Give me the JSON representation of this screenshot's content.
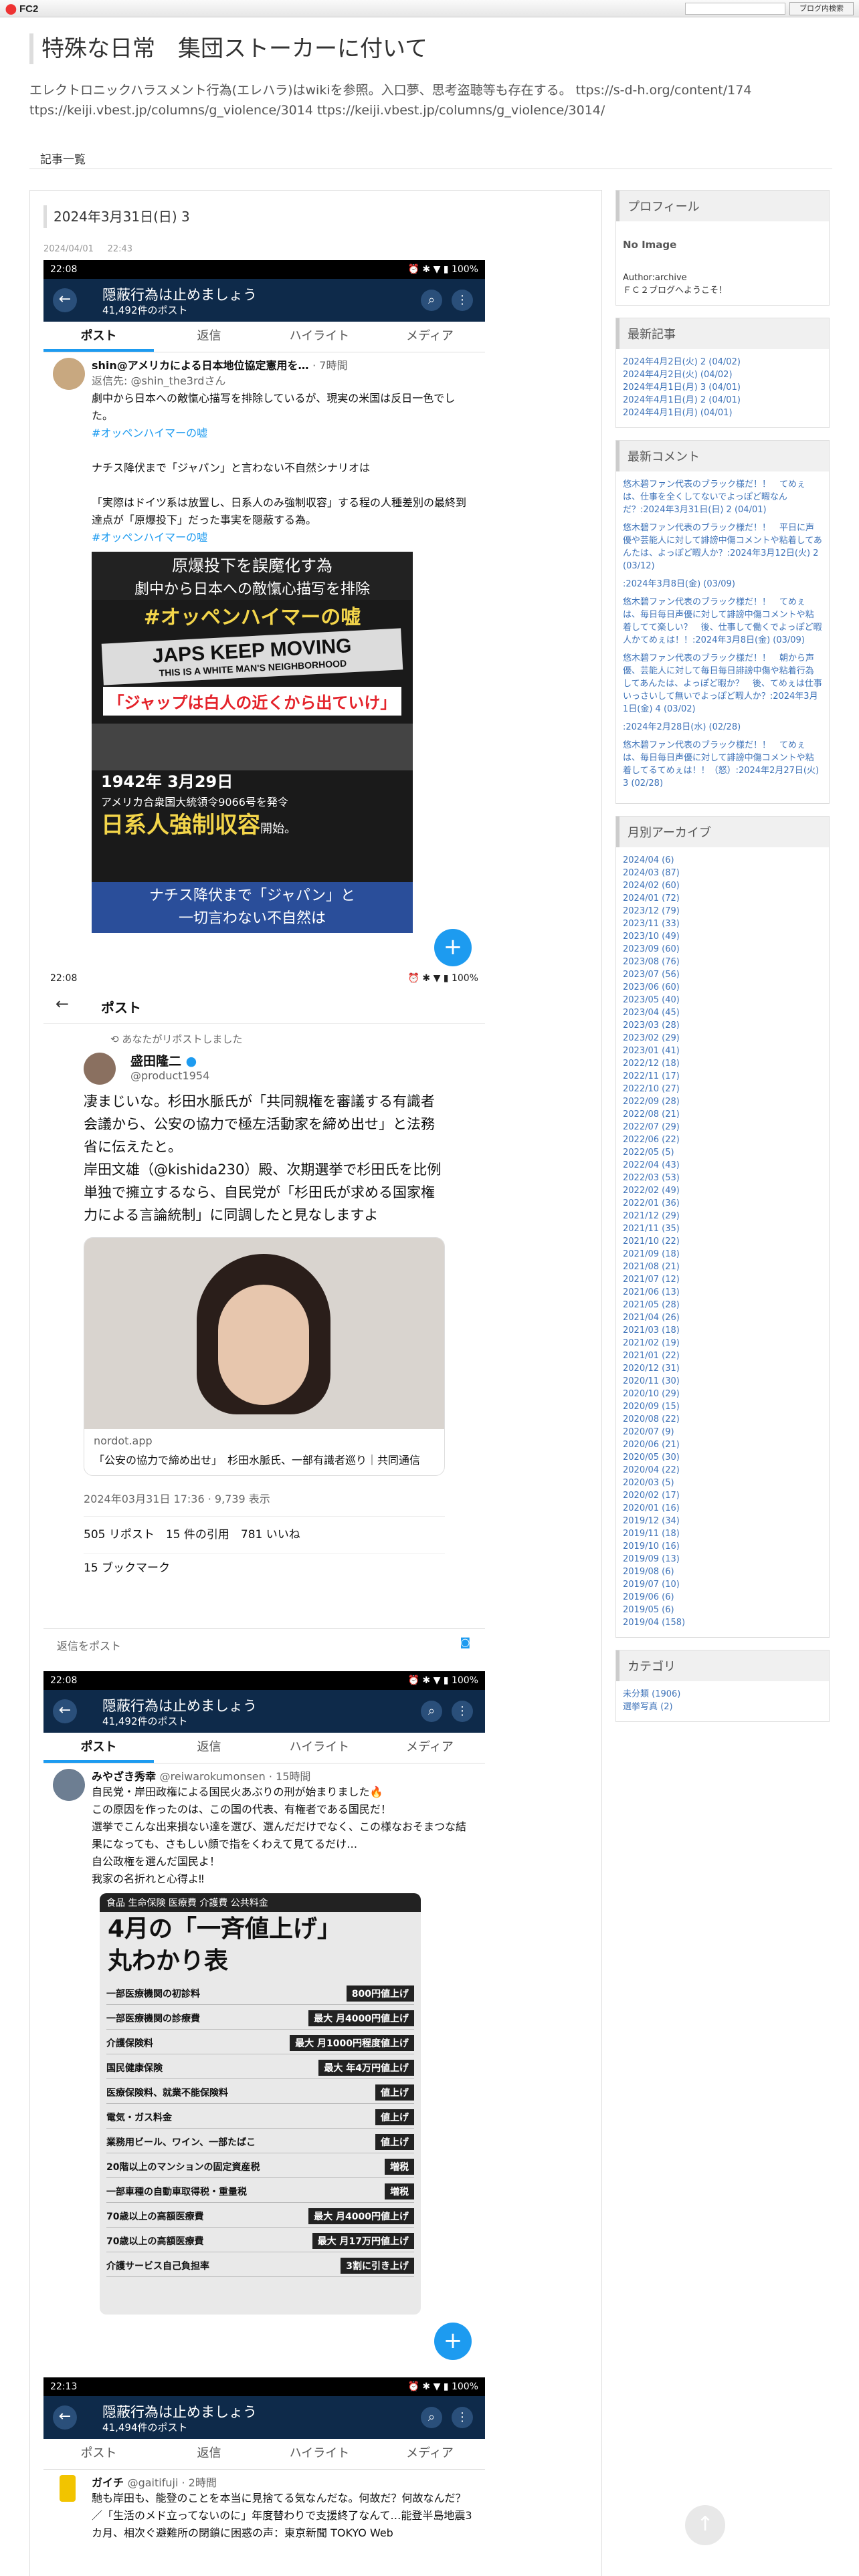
{
  "topbar": {
    "logo": "FC2",
    "search_button": "ブログ内検索"
  },
  "blog": {
    "title": "特殊な日常　集団ストーカーに付いて",
    "description": "エレクトロニックハラスメント行為(エレハラ)はwikiを参照。入口夢、思考盗聴等も存在する。 ttps://s-d-h.org/content/174 ttps://keiji.vbest.jp/columns/g_violence/3014 ttps://keiji.vbest.jp/columns/g_violence/3014/"
  },
  "nav": {
    "list_link": "記事一覧"
  },
  "entry": {
    "heading": "2024年3月31日(日) 3",
    "date": "2024/04/01",
    "time": "22:43"
  },
  "shot1": {
    "time": "22:08",
    "status": "⏰ ✱ ▼ ▮ 100%",
    "header_title": "隠蔽行為は止めましょう",
    "header_sub": "41,492件のポスト",
    "tabs": [
      "ポスト",
      "返信",
      "ハイライト",
      "メディア"
    ],
    "author": "shin@アメリカによる日本地位協定憲用を…",
    "author_time": "· 7時間",
    "reply_to": "返信先: @shin_the3rdさん",
    "lines": [
      "劇中から日本への敵愾心描写を排除しているが、現実の米国は反日一色でした。",
      "#オッペンハイマーの嘘",
      "",
      "ナチス降伏まで「ジャパン」と言わない不自然シナリオは",
      "",
      "「実際はドイツ系は放置し、日系人のみ強制収容」する程の人種差別の最終到達点が「原爆投下」だった事実を隠蔽する為。",
      "#オッペンハイマーの嘘"
    ],
    "poster": {
      "line1": "原爆投下を誤魔化す為",
      "line2": "劇中から日本への敵愾心描写を排除",
      "hashtag": "#オッペンハイマーの嘘",
      "sign1": "JAPS KEEP MOVING",
      "sign2": "THIS IS A WHITE MAN'S NEIGHBORHOOD",
      "red_caption": "「ジャップは白人の近くから出ていけ」",
      "date_line": "1942年 3月29日",
      "order_line": "アメリカ合衆国大統領令9066号を発令",
      "yellow_big": "日系人強制収容",
      "yellow_tail": "開始。",
      "bottom1": "ナチス降伏まで「ジャパン」と",
      "bottom2": "一切言わない不自然は"
    },
    "fab": "+"
  },
  "shot2": {
    "time": "22:08",
    "status": "⏰ ✱ ▼ ▮ 100%",
    "header": "ポスト",
    "repost_note": "あなたがリポストしました",
    "author": "盛田隆二",
    "handle": "@product1954",
    "lines": [
      "凄まじいな。杉田水脈氏が「共同親権を審議する有識者会議から、公安の協力で極左活動家を締め出せ」と法務省に伝えたと。",
      "岸田文雄（@kishida230）殿、次期選挙で杉田氏を比例単独で擁立するなら、自民党が「杉田氏が求める国家権力による言論統制」に同調したと見なしますよ"
    ],
    "card_domain": "nordot.app",
    "card_title": "「公安の協力で締め出せ」　杉田水脈氏、一部有識者巡り｜共同通信",
    "meta": "2024年03月31日 17:36 · 9,739 表示",
    "stats": "505 リポスト　15 件の引用　781 いいね",
    "bookmarks": "15 ブックマーク",
    "reply_placeholder": "返信をポスト"
  },
  "shot3": {
    "time": "22:08",
    "status": "⏰ ✱ ▼ ▮ 100%",
    "header_title": "隠蔽行為は止めましょう",
    "header_sub": "41,492件のポスト",
    "tabs": [
      "ポスト",
      "返信",
      "ハイライト",
      "メディア"
    ],
    "author": "みやざき秀幸",
    "handle": "@reiwarokumonsen · 15時間",
    "lines": [
      "自民党・岸田政権による国民火あぶりの刑が始まりました🔥",
      "この原因を作ったのは、この国の代表、有権者である国民だ！",
      "選挙でこんな出来損ない達を選び、選んだだけでなく、この様なおそまつな結果になっても、さもしい顔で指をくわえて見てるだけ…",
      "自公政権を選んだ国民よ！",
      "我家の名折れと心得よ‼"
    ],
    "poster_top": "食品 生命保険 医療費 介護費 公共料金",
    "poster_title1": "4月の「一斉値上げ」",
    "poster_title2": "丸わかり表",
    "rows": [
      {
        "label": "一部医療機関の初診料",
        "tag": "800円値上げ"
      },
      {
        "label": "一部医療機関の診療費",
        "tag": "最大 月4000円値上げ"
      },
      {
        "label": "介護保険料",
        "tag": "最大 月1000円程度値上げ"
      },
      {
        "label": "国民健康保険",
        "tag": "最大 年4万円値上げ"
      },
      {
        "label": "医療保険料、就業不能保険料",
        "tag": "値上げ"
      },
      {
        "label": "電気・ガス料金",
        "tag": "値上げ"
      },
      {
        "label": "業務用ビール、ワイン、一部たばこ",
        "tag": "値上げ"
      },
      {
        "label": "20階以上のマンションの固定資産税",
        "tag": "増税"
      },
      {
        "label": "一部車種の自動車取得税・重量税",
        "tag": "増税"
      },
      {
        "label": "70歳以上の高額医療費",
        "tag": "最大 月4000円値上げ"
      },
      {
        "label": "70歳以上の高額医療費",
        "tag": "最大 月17万円値上げ"
      },
      {
        "label": "介護サービス自己負担率",
        "tag": "3割に引き上げ"
      }
    ],
    "fab": "+"
  },
  "shot4": {
    "time": "22:13",
    "status": "⏰ ✱ ▼ ▮ 100%",
    "header_title": "隠蔽行為は止めましょう",
    "header_sub": "41,494件のポスト",
    "tabs": [
      "ポスト",
      "返信",
      "ハイライト",
      "メディア"
    ],
    "author": "ガイチ",
    "handle": "@gaitifuji · 2時間",
    "lines": [
      "馳も岸田も、能登のことを本当に見捨てる気なんだな。何故だ？何故なんだ？／「生活のメド立ってないのに」年度替わりで支援終了なんて…能登半島地震3カ月、相次ぐ避難所の閉鎖に困惑の声：東京新聞 TOKYO Web"
    ]
  },
  "sidebar": {
    "profile_title": "プロフィール",
    "no_image": "No Image",
    "author_line": "Author:archive",
    "welcome": "ＦＣ２ブログへようこそ！",
    "recent_title": "最新記事",
    "recent": [
      "2024年4月2日(火) 2 (04/02)",
      "2024年4月2日(火) (04/02)",
      "2024年4月1日(月) 3 (04/01)",
      "2024年4月1日(月) 2 (04/01)",
      "2024年4月1日(月) (04/01)"
    ],
    "comments_title": "最新コメント",
    "comments": [
      "悠木碧ファン代表のブラック様だ！！　てめぇは、仕事を全くしてないでよっぽど暇なんだ？:2024年3月31日(日) 2 (04/01)",
      "悠木碧ファン代表のブラック様だ！！　平日に声優や芸能人に対して誹謗中傷コメントや粘着してあんたは、よっぽど暇人か？:2024年3月12日(火) 2 (03/12)",
      ":2024年3月8日(金) (03/09)",
      "悠木碧ファン代表のブラック様だ！！　てめぇは、毎日毎日声優に対して誹謗中傷コメントや粘着してて楽しい？　後、仕事して働くでよっぽど暇人かてめぇは！！:2024年3月8日(金) (03/09)",
      "悠木碧ファン代表のブラック様だ！！　朝から声優、芸能人に対して毎日毎日誹謗中傷や粘着行為してあんたは、よっぽど暇か？　後、てめぇは仕事いっさいして無いでよっぽど暇人か？:2024年3月1日(金) 4 (03/02)",
      ":2024年2月28日(水) (02/28)",
      "悠木碧ファン代表のブラック様だ！！　てめぇは、毎日毎日声優に対して誹謗中傷コメントや粘着してるてめぇは！！（怒）:2024年2月27日(火) 3 (02/28)"
    ],
    "archive_title": "月別アーカイブ",
    "archives": [
      "2024/04 (6)",
      "2024/03 (87)",
      "2024/02 (60)",
      "2024/01 (72)",
      "2023/12 (79)",
      "2023/11 (33)",
      "2023/10 (49)",
      "2023/09 (60)",
      "2023/08 (76)",
      "2023/07 (56)",
      "2023/06 (60)",
      "2023/05 (40)",
      "2023/04 (45)",
      "2023/03 (28)",
      "2023/02 (29)",
      "2023/01 (41)",
      "2022/12 (18)",
      "2022/11 (17)",
      "2022/10 (27)",
      "2022/09 (28)",
      "2022/08 (21)",
      "2022/07 (29)",
      "2022/06 (22)",
      "2022/05 (5)",
      "2022/04 (43)",
      "2022/03 (53)",
      "2022/02 (49)",
      "2022/01 (36)",
      "2021/12 (29)",
      "2021/11 (35)",
      "2021/10 (22)",
      "2021/09 (18)",
      "2021/08 (21)",
      "2021/07 (12)",
      "2021/06 (13)",
      "2021/05 (28)",
      "2021/04 (26)",
      "2021/03 (18)",
      "2021/02 (19)",
      "2021/01 (22)",
      "2020/12 (31)",
      "2020/11 (30)",
      "2020/10 (29)",
      "2020/09 (15)",
      "2020/08 (22)",
      "2020/07 (9)",
      "2020/06 (21)",
      "2020/05 (30)",
      "2020/04 (22)",
      "2020/03 (5)",
      "2020/02 (17)",
      "2020/01 (16)",
      "2019/12 (34)",
      "2019/11 (18)",
      "2019/10 (16)",
      "2019/09 (13)",
      "2019/08 (6)",
      "2019/07 (10)",
      "2019/06 (6)",
      "2019/05 (6)",
      "2019/04 (158)"
    ],
    "category_title": "カテゴリ",
    "categories": [
      "未分類 (1906)",
      "選挙写真 (2)"
    ]
  },
  "scroll_top": "↑"
}
